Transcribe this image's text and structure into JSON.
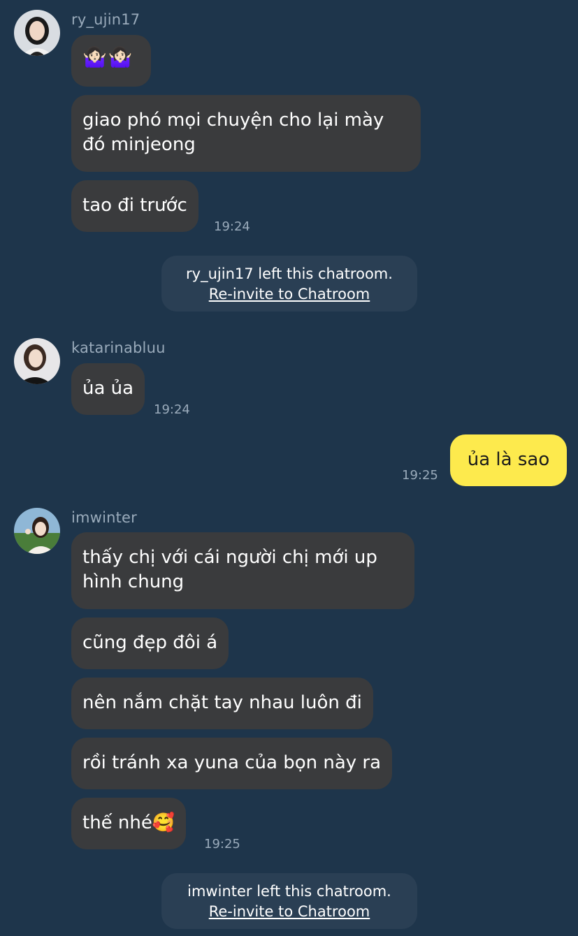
{
  "groups": [
    {
      "sender": "ry_ujin17",
      "avatar": "avatar-ryujin",
      "messages": [
        "🤷🏻‍♀️🤷🏻‍♀️",
        "giao phó mọi chuyện cho lại mày đó minjeong",
        "tao đi trước"
      ],
      "time": "19:24"
    },
    {
      "sender": "katarinabluu",
      "avatar": "avatar-katarina",
      "messages": [
        "ủa ủa"
      ],
      "time": "19:24"
    },
    {
      "sender": "imwinter",
      "avatar": "avatar-winter",
      "messages": [
        "thấy chị với cái người chị mới up hình chung",
        "cũng đẹp đôi á",
        "nên nắm chặt tay nhau luôn đi",
        "rồi tránh xa yuna của bọn này ra",
        "thế nhé🥰"
      ],
      "time": "19:25"
    }
  ],
  "my_message": {
    "text": "ủa là sao",
    "time": "19:25"
  },
  "notices": [
    {
      "text": "ry_ujin17 left this chatroom.",
      "link": "Re-invite to Chatroom"
    },
    {
      "text": "imwinter left this chatroom.",
      "link": "Re-invite to Chatroom"
    }
  ],
  "colors": {
    "background": "#1e354b",
    "bubble_other": "#3a3b3d",
    "bubble_mine": "#fdea4d",
    "notice_bg": "#2a3f54"
  }
}
